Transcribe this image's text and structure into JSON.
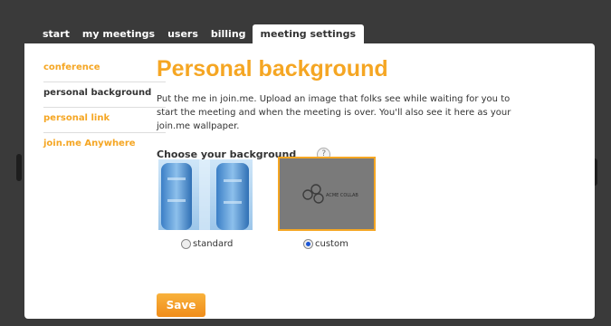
{
  "nav": {
    "tabs": [
      {
        "label": "start"
      },
      {
        "label": "my meetings"
      },
      {
        "label": "users"
      },
      {
        "label": "billing"
      },
      {
        "label": "meeting settings",
        "active": true
      }
    ]
  },
  "sidebar": {
    "items": [
      {
        "label": "conference"
      },
      {
        "label": "personal background",
        "active": true
      },
      {
        "label": "personal link"
      },
      {
        "label": "join.me Anywhere"
      }
    ]
  },
  "main": {
    "title": "Personal background",
    "description": "Put the me in join.me. Upload an image that folks see while waiting for you to start the meeting and when the meeting is over. You'll also see it here as your join.me wallpaper.",
    "choose_label": "Choose your background",
    "help_glyph": "?",
    "options": {
      "standard": {
        "label": "standard",
        "selected": false
      },
      "custom": {
        "label": "custom",
        "selected": true,
        "logo_text": "ACME COLLAB"
      }
    },
    "save_label": "Save"
  },
  "colors": {
    "accent": "#f5a623",
    "dark": "#3a3a3a",
    "selected_radio": "#1a56d6"
  }
}
